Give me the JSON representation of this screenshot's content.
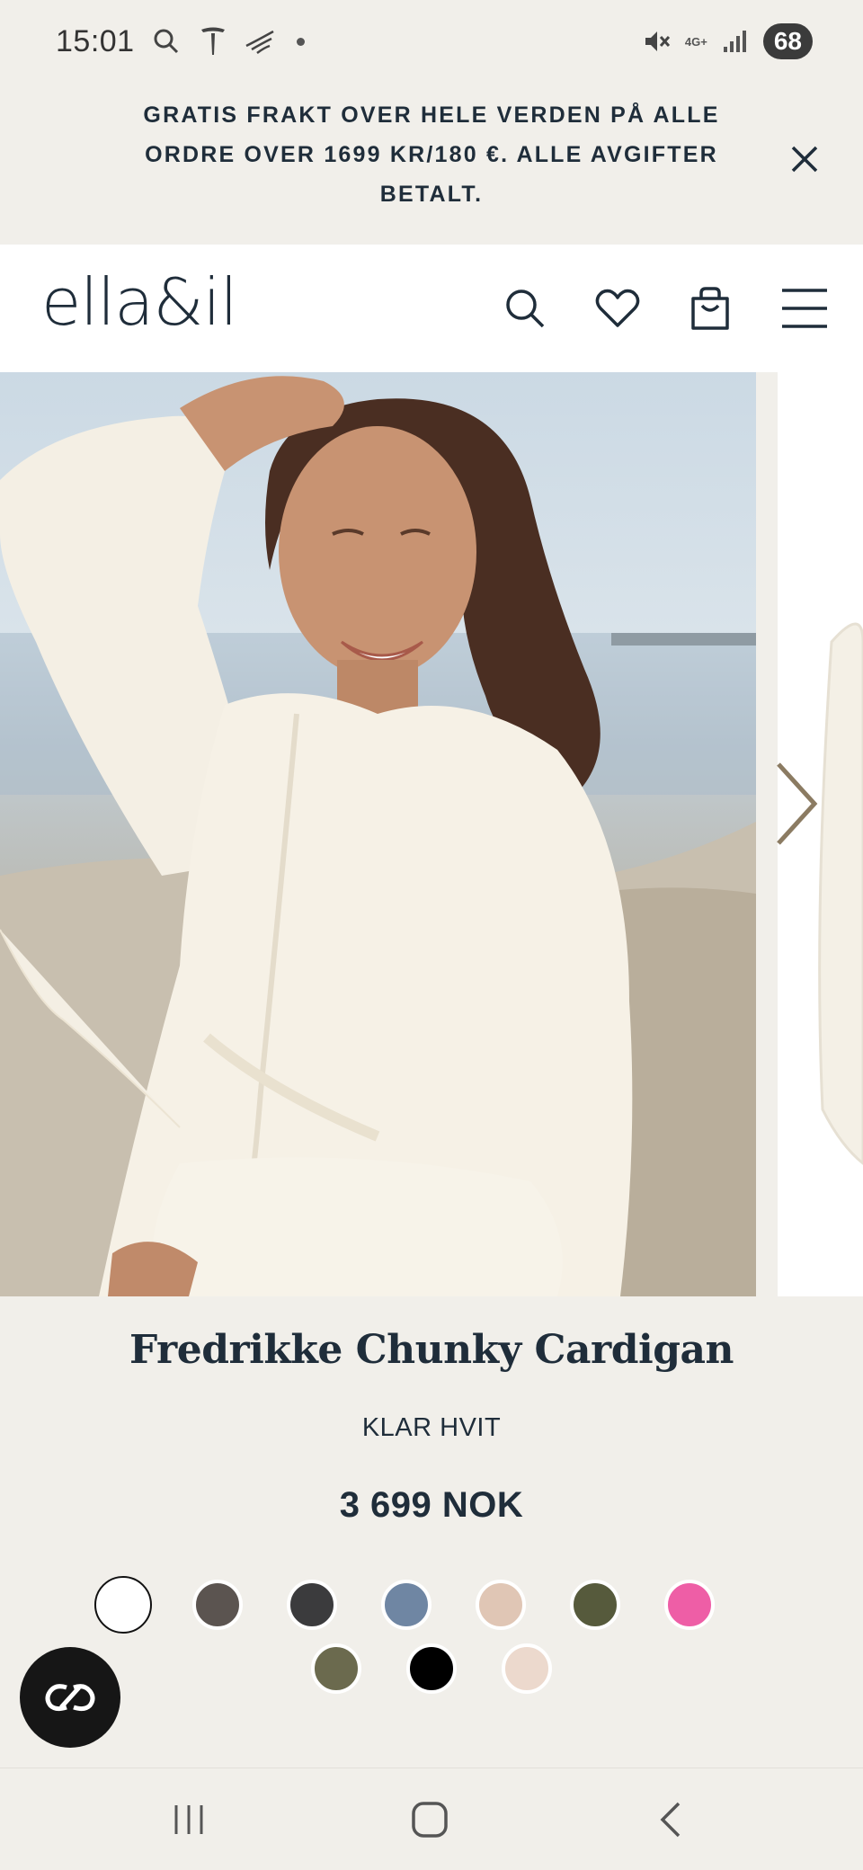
{
  "status_bar": {
    "time": "15:01",
    "battery": "68",
    "network": "4G+"
  },
  "announcement": {
    "text": "GRATIS FRAKT OVER HELE VERDEN PÅ ALLE ORDRE OVER 1699 KR/180 €. ALLE AVGIFTER BETALT.",
    "close_icon": "close-icon"
  },
  "header": {
    "logo": "ella&il",
    "icons": [
      "search-icon",
      "heart-icon",
      "bag-icon",
      "menu-icon"
    ]
  },
  "product": {
    "title": "Fredrikke Chunky Cardigan",
    "color_name": "KLAR HVIT",
    "price": "3 699 NOK",
    "swatches": [
      {
        "color": "#ffffff",
        "selected": true
      },
      {
        "color": "#5b5450"
      },
      {
        "color": "#3b3b3d"
      },
      {
        "color": "#6f86a3"
      },
      {
        "color": "#e0c6b5"
      },
      {
        "color": "#565a3c"
      },
      {
        "color": "#ee5ea6"
      },
      {
        "color": "#6b6a4e"
      },
      {
        "color": "#000000"
      },
      {
        "color": "#ecd9cd"
      }
    ]
  },
  "colors": {
    "page_bg": "#f1efea",
    "text_navy": "#1f2d3a",
    "arrow_tan": "#8b7b62",
    "chat_bg": "#161616"
  }
}
